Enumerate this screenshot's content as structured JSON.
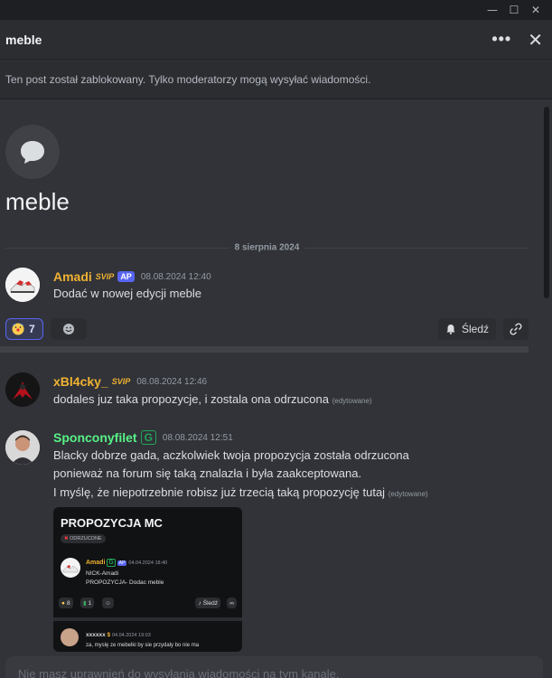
{
  "window": {
    "minimize": "—",
    "maximize": "☐",
    "close": "✕"
  },
  "header": {
    "title": "meble",
    "more": "•••",
    "close": "✕"
  },
  "locked_notice": "Ten post został zablokowany. Tylko moderatorzy mogą wysyłać wiadomości.",
  "thread": {
    "title": "meble"
  },
  "date_divider": "8 sierpnia 2024",
  "messages": [
    {
      "author": "Amadi",
      "author_color": "#f0b232",
      "badges": [
        "SVIP",
        "AP"
      ],
      "timestamp": "08.08.2024 12:40",
      "text": "Dodać w nowej edycji meble"
    },
    {
      "author": "xBl4cky_",
      "author_color": "#f0b232",
      "badges": [
        "SVIP"
      ],
      "timestamp": "08.08.2024 12:46",
      "text": "dodales juz taka propozycje, i zostala ona odrzucona",
      "edited": "(edytowane)"
    },
    {
      "author": "Sponconyfilet",
      "author_color": "#57f287",
      "badges": [
        "G"
      ],
      "timestamp": "08.08.2024 12:51",
      "lines": [
        "Blacky dobrze gada, aczkolwiek twoja propozycja została odrzucona",
        "ponieważ na forum się taką znalazła i była zaakceptowana.",
        "I myślę, że niepotrzebnie robisz już trzecią taką propozycję tutaj"
      ],
      "edited": "(edytowane)"
    }
  ],
  "reactions": {
    "count": "7",
    "follow_label": "Śledź"
  },
  "embed": {
    "title": "PROPOZYCJA MC",
    "tag": "ODRZUCONE",
    "author": "Amadi",
    "timestamp": "04.04.2024 18:40",
    "line1": "NICK-Amadi",
    "line2": "PROPOZYCJA- Dodac meble",
    "react1": "8",
    "react2": "1",
    "follow": "Śledź",
    "author2": "xxxxxx",
    "timestamp2": "04.04.2024 19:03",
    "line3": "za, myslę ze mebelki by sie przydaly bo nie ma"
  },
  "composer_placeholder": "Nie masz uprawnień do wysyłania wiadomości na tym kanale."
}
